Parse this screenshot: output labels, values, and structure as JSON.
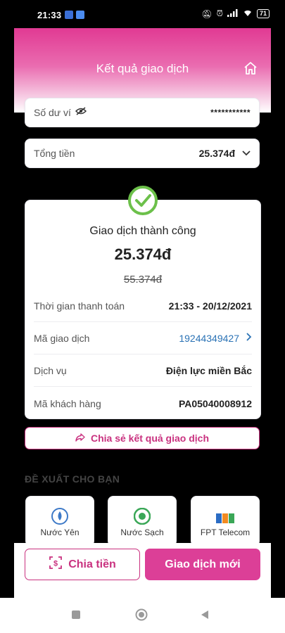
{
  "status_bar": {
    "time": "21:33",
    "battery": "71",
    "icons": [
      "facebook-icon",
      "app-icon",
      "mute-icon",
      "alarm-icon",
      "signal-icon",
      "wifi-icon",
      "battery-icon"
    ]
  },
  "header": {
    "title": "Kết quả giao dịch"
  },
  "balance": {
    "label": "Số dư ví",
    "masked_value": "***********"
  },
  "total": {
    "label": "Tổng tiền",
    "value": "25.374đ"
  },
  "result": {
    "status": "Giao dịch thành công",
    "amount": "25.374đ",
    "original_amount": "55.374đ",
    "details": [
      {
        "label": "Thời gian thanh toán",
        "value": "21:33 - 20/12/2021"
      },
      {
        "label": "Mã giao dịch",
        "value": "19244349427"
      },
      {
        "label": "Dịch vụ",
        "value": "Điện lực miền Bắc"
      },
      {
        "label": "Mã khách hàng",
        "value": "PA05040008912"
      }
    ]
  },
  "share_button": "Chia sẻ kết quả giao dịch",
  "suggestions": {
    "title": "ĐỀ XUẤT CHO BẠN",
    "items": [
      {
        "label": "Nước Yên"
      },
      {
        "label": "Nước Sạch"
      },
      {
        "label": "FPT Telecom"
      }
    ]
  },
  "actions": {
    "split": "Chia tiền",
    "new": "Giao dịch mới"
  },
  "colors": {
    "accent": "#dc3f97",
    "success": "#6cc04a",
    "link": "#2a72b5"
  }
}
